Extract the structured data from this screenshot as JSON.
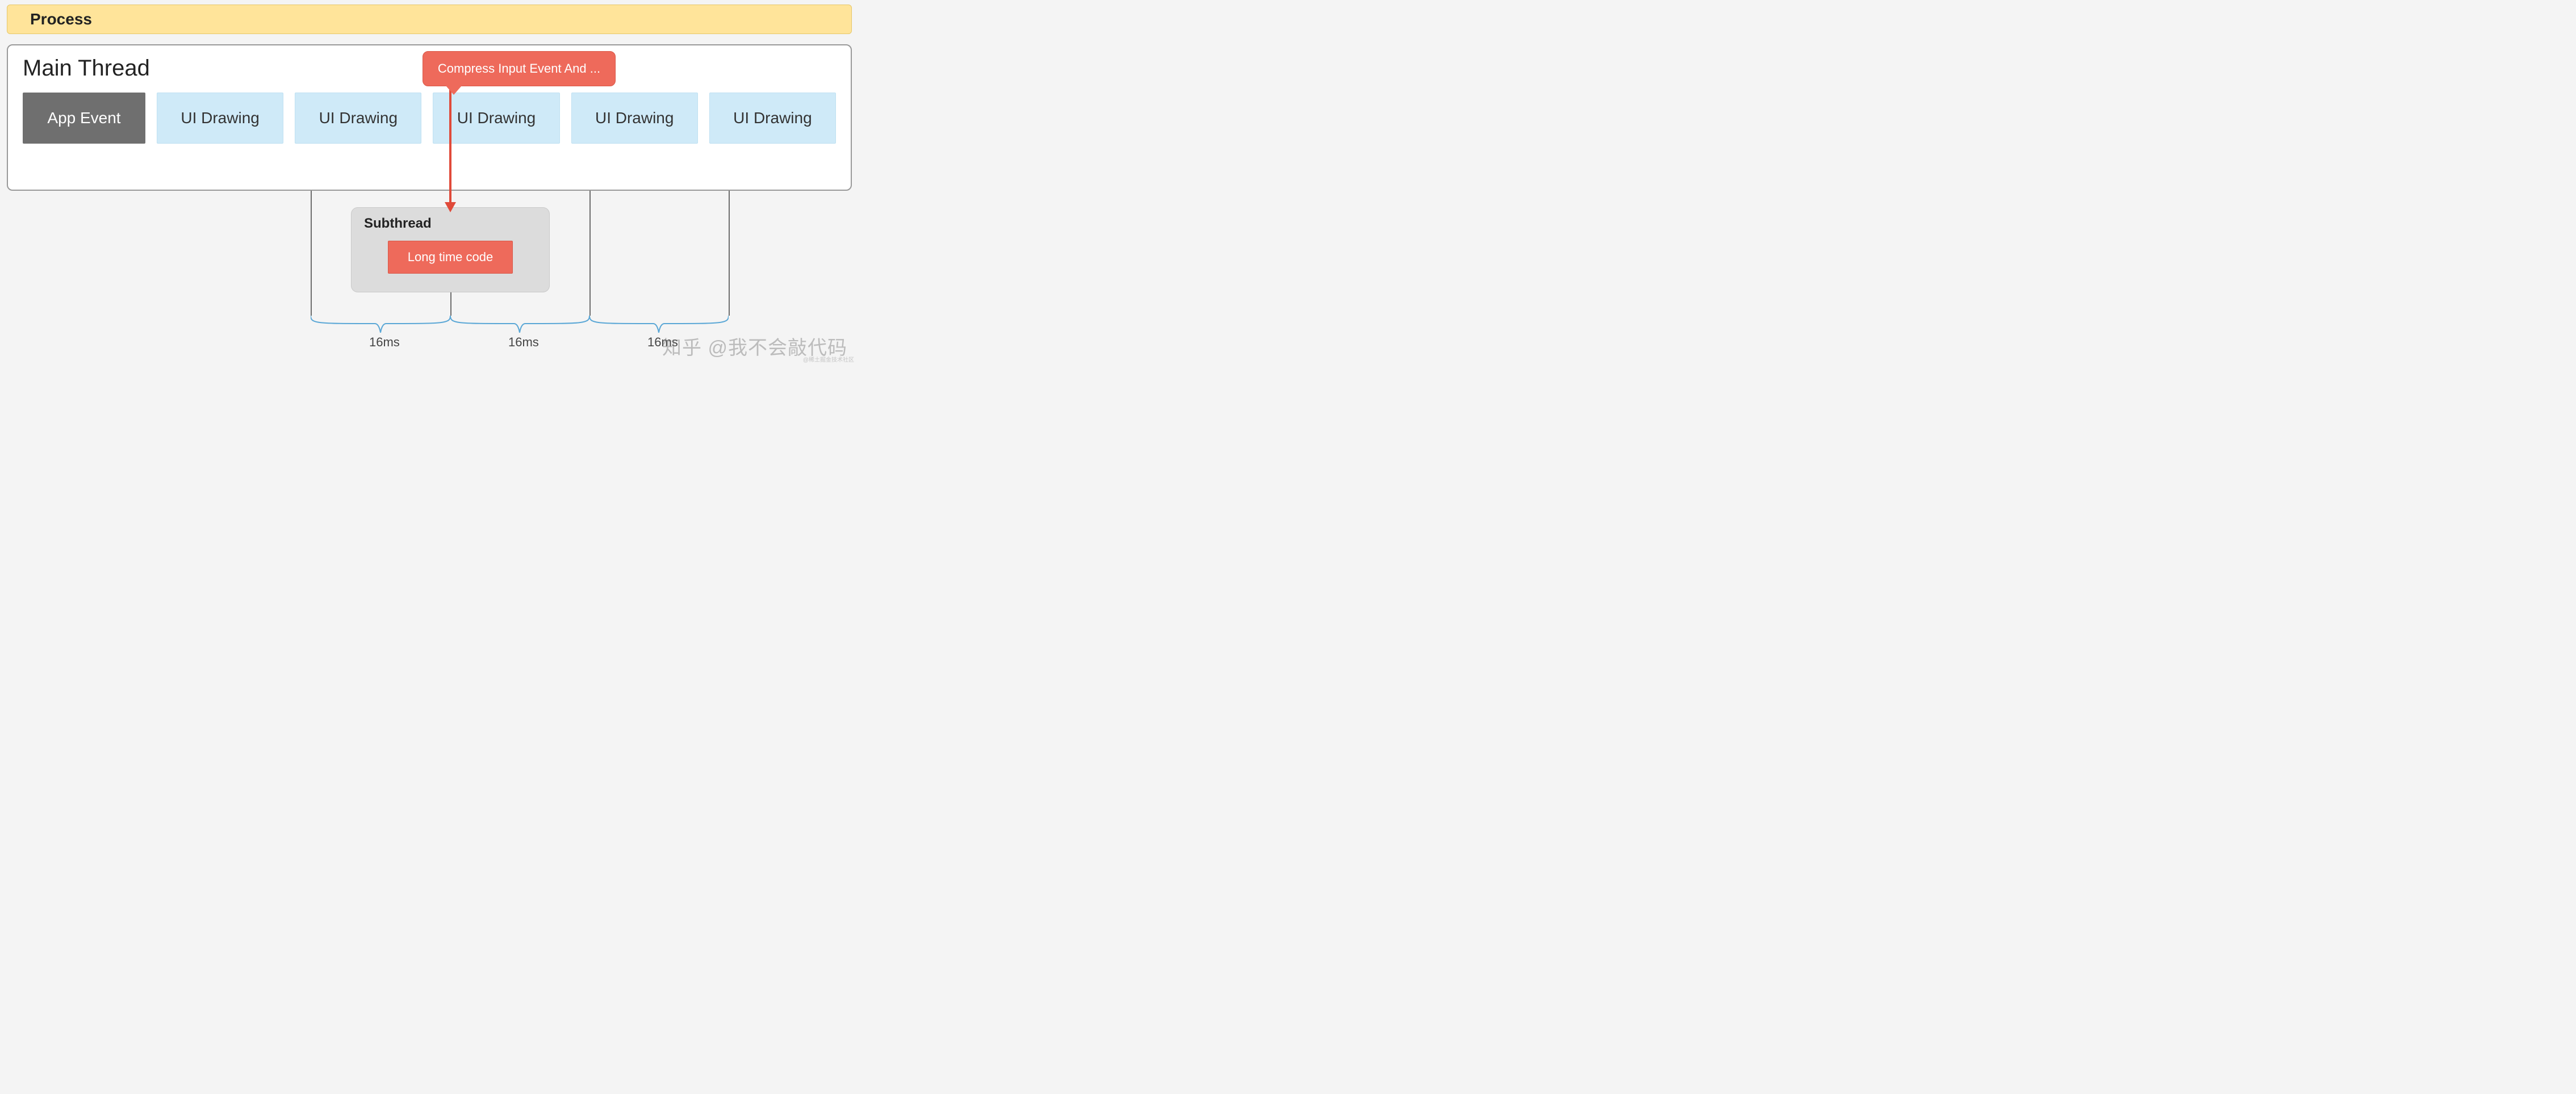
{
  "process": {
    "title": "Process"
  },
  "main_thread": {
    "title": "Main Thread",
    "events": [
      {
        "label": "App Event",
        "kind": "app"
      },
      {
        "label": "UI Drawing",
        "kind": "ui"
      },
      {
        "label": "UI Drawing",
        "kind": "ui"
      },
      {
        "label": "UI Drawing",
        "kind": "ui"
      },
      {
        "label": "UI Drawing",
        "kind": "ui"
      },
      {
        "label": "UI Drawing",
        "kind": "ui"
      }
    ]
  },
  "callout": {
    "text": "Compress Input Event And ..."
  },
  "subthread": {
    "title": "Subthread",
    "task": "Long time code"
  },
  "timeline": {
    "intervals": [
      "16ms",
      "16ms",
      "16ms"
    ]
  },
  "watermark": "知乎 @我不会敲代码",
  "watermark_small": "@稀土掘金技术社区"
}
